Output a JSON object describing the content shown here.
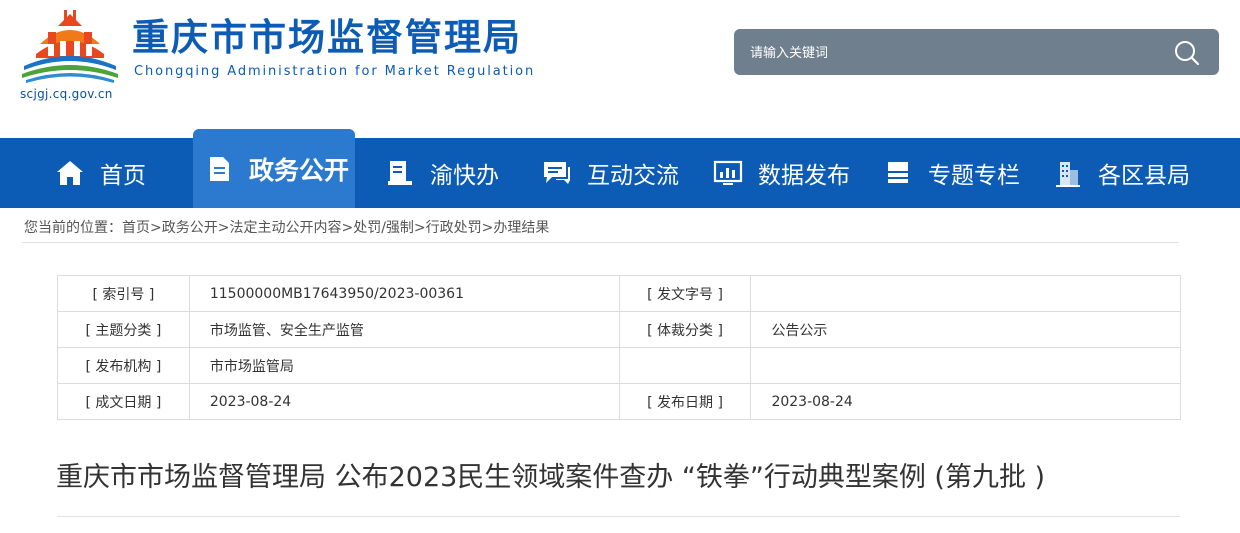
{
  "header": {
    "site_name_cn": "重庆市市场监督管理局",
    "site_name_en": "Chongqing  Administration for Market Regulation",
    "domain": "scjgj.cq.gov.cn",
    "search": {
      "placeholder": "请输入关键词",
      "icon": "search-icon"
    }
  },
  "nav": {
    "items": [
      {
        "label": "首页",
        "icon": "home-icon"
      },
      {
        "label": "政务公开",
        "icon": "document-icon",
        "active": true
      },
      {
        "label": "渝快办",
        "icon": "form-icon"
      },
      {
        "label": "互动交流",
        "icon": "chat-icon"
      },
      {
        "label": "数据发布",
        "icon": "chart-icon"
      },
      {
        "label": "专题专栏",
        "icon": "list-icon"
      },
      {
        "label": "各区县局",
        "icon": "building-icon"
      }
    ]
  },
  "breadcrumb": {
    "prefix": "您当前的位置：",
    "items": [
      "首页",
      "政务公开",
      "法定主动公开内容",
      "处罚/强制",
      "行政处罚",
      "办理结果"
    ],
    "separator": ">"
  },
  "meta": {
    "rows": [
      {
        "k1": "[ 索引号 ]",
        "v1": "11500000MB17643950/2023-00361",
        "k2": "[ 发文字号 ]",
        "v2": ""
      },
      {
        "k1": "[ 主题分类 ]",
        "v1": "市场监管、安全生产监管",
        "k2": "[ 体裁分类 ]",
        "v2": "公告公示"
      },
      {
        "k1": "[ 发布机构 ]",
        "v1": "市市场监管局",
        "k2": "",
        "v2": ""
      },
      {
        "k1": "[ 成文日期 ]",
        "v1": "2023-08-24",
        "k2": "[ 发布日期 ]",
        "v2": "2023-08-24"
      }
    ]
  },
  "article": {
    "title": "重庆市市场监督管理局 公布2023民生领域案件查办 “铁拳”行动典型案例 (第九批 )"
  },
  "colors": {
    "brand_blue": "#0c5bb5",
    "nav_active": "#2b7ad0",
    "search_bg": "#6f7f8e"
  }
}
